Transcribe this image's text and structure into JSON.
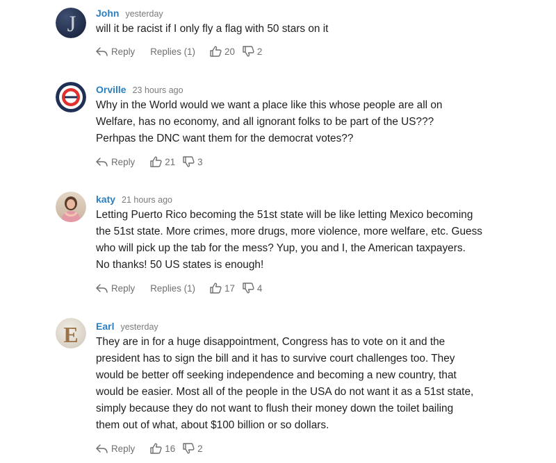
{
  "colors": {
    "author": "#2a7fc1",
    "meta": "#7b7b7b",
    "text": "#1d1d1f",
    "action": "#6f6f6f"
  },
  "comments": [
    {
      "author": "John",
      "time": "yesterday",
      "avatar_icon": "letter-j-avatar",
      "lines": [
        "will it be racist if I only fly a flag with 50 stars on it"
      ],
      "reply_label": "Reply",
      "replies_label": "Replies (1)",
      "likes": "20",
      "dislikes": "2"
    },
    {
      "author": "Orville",
      "time": "23 hours ago",
      "avatar_icon": "target-avatar",
      "lines": [
        "Why in the World would we want a place like this whose people are all on",
        "Welfare, has no economy, and all ignorant folks to be part of the US???",
        "Perhpas the DNC want them for the democrat votes??"
      ],
      "reply_label": "Reply",
      "likes": "21",
      "dislikes": "3"
    },
    {
      "author": "katy",
      "time": "21 hours ago",
      "avatar_icon": "photo-avatar",
      "lines": [
        "Letting Puerto Rico becoming the 51st state will be like letting Mexico becoming",
        "the 51st state. More crimes, more drugs, more violence, more welfare, etc. Guess",
        "who will pick up the tab for the mess? Yup, you and I, the American taxpayers.",
        "No thanks! 50 US states is enough!"
      ],
      "reply_label": "Reply",
      "replies_label": "Replies (1)",
      "likes": "17",
      "dislikes": "4"
    },
    {
      "author": "Earl",
      "time": "yesterday",
      "avatar_icon": "letter-e-avatar",
      "lines": [
        "They are in for a huge disappointment, Congress has to vote on it and the",
        "president has to sign the bill and it has to survive court challenges too. They",
        "would be better off seeking independence and becoming a new country, that",
        "would be easier. Most all of the people in the USA do not want it as a 51st state,",
        "simply because they do not want to flush their money down the toilet bailing",
        "them out of what, about $100 billion or so dollars."
      ],
      "reply_label": "Reply",
      "likes": "16",
      "dislikes": "2"
    }
  ]
}
